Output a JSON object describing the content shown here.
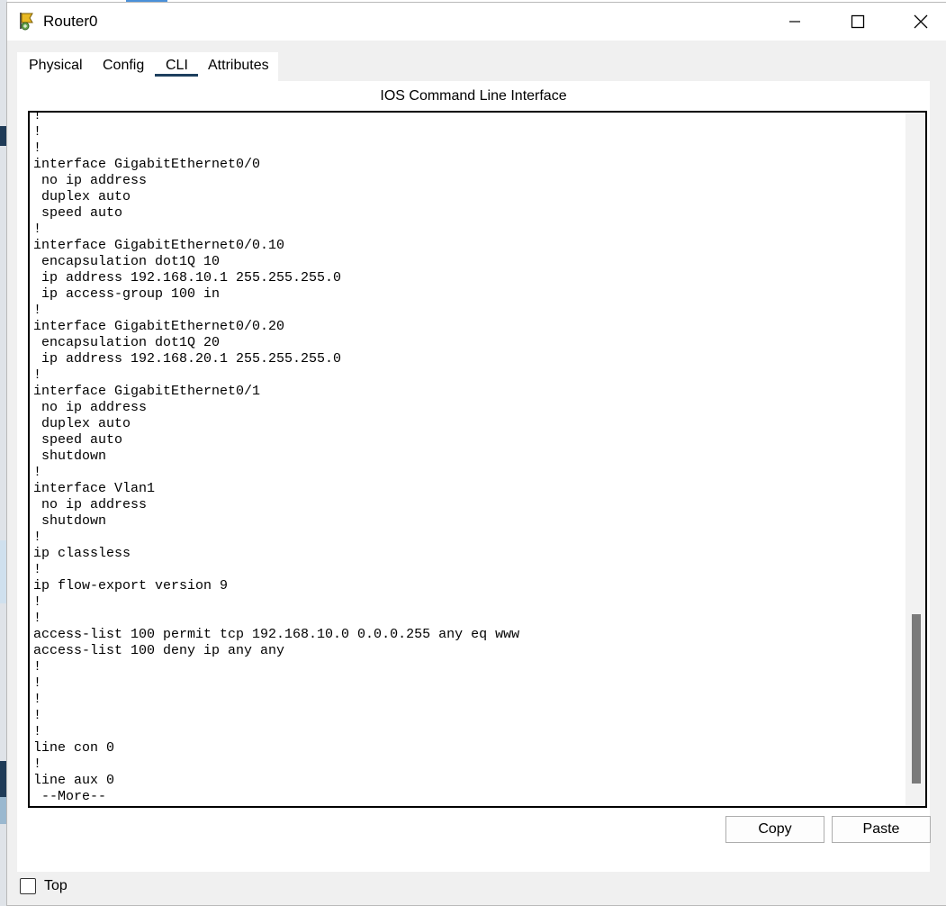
{
  "window": {
    "title": "Router0",
    "icon": "router-icon",
    "controls": [
      "minimize-icon",
      "maximize-icon",
      "close-icon"
    ]
  },
  "tabs": [
    {
      "label": "Physical",
      "selected": false
    },
    {
      "label": "Config",
      "selected": false
    },
    {
      "label": "CLI",
      "selected": true
    },
    {
      "label": "Attributes",
      "selected": false
    }
  ],
  "cli": {
    "heading": "IOS Command Line Interface",
    "lines": [
      "!",
      "!",
      "!",
      "interface GigabitEthernet0/0",
      " no ip address",
      " duplex auto",
      " speed auto",
      "!",
      "interface GigabitEthernet0/0.10",
      " encapsulation dot1Q 10",
      " ip address 192.168.10.1 255.255.255.0",
      " ip access-group 100 in",
      "!",
      "interface GigabitEthernet0/0.20",
      " encapsulation dot1Q 20",
      " ip address 192.168.20.1 255.255.255.0",
      "!",
      "interface GigabitEthernet0/1",
      " no ip address",
      " duplex auto",
      " speed auto",
      " shutdown",
      "!",
      "interface Vlan1",
      " no ip address",
      " shutdown",
      "!",
      "ip classless",
      "!",
      "ip flow-export version 9",
      "!",
      "!",
      "access-list 100 permit tcp 192.168.10.0 0.0.0.255 any eq www",
      "access-list 100 deny ip any any",
      "!",
      "!",
      "!",
      "!",
      "!",
      "line con 0",
      "!",
      "line aux 0",
      " --More--"
    ]
  },
  "buttons": {
    "copy": "Copy",
    "paste": "Paste"
  },
  "footer": {
    "top_label": "Top",
    "top_checked": false
  },
  "colors": {
    "tab_underline": "#1d3f5e",
    "scrollbar_thumb": "#7a7a7a"
  }
}
